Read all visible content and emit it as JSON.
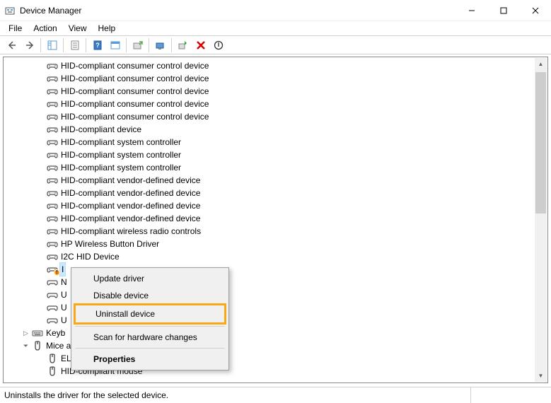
{
  "window": {
    "title": "Device Manager"
  },
  "menubar": {
    "file": "File",
    "action": "Action",
    "view": "View",
    "help": "Help"
  },
  "tree": {
    "devices": [
      "HID-compliant consumer control device",
      "HID-compliant consumer control device",
      "HID-compliant consumer control device",
      "HID-compliant consumer control device",
      "HID-compliant consumer control device",
      "HID-compliant device",
      "HID-compliant system controller",
      "HID-compliant system controller",
      "HID-compliant system controller",
      "HID-compliant vendor-defined device",
      "HID-compliant vendor-defined device",
      "HID-compliant vendor-defined device",
      "HID-compliant vendor-defined device",
      "HID-compliant wireless radio controls",
      "HP Wireless Button Driver",
      "I2C HID Device"
    ],
    "selected_warning": "I",
    "partial_labels": {
      "n": "N",
      "u1": "U",
      "u2": "U",
      "u3": "U"
    },
    "keyboards_label": "Keyb",
    "mice_label": "Mice and other pointing devices",
    "mice_children": {
      "elan": "ELAN Input Device",
      "hid_mouse": "HID-compliant mouse"
    }
  },
  "context_menu": {
    "update": "Update driver",
    "disable": "Disable device",
    "uninstall": "Uninstall device",
    "scan": "Scan for hardware changes",
    "properties": "Properties"
  },
  "statusbar": {
    "text": "Uninstalls the driver for the selected device."
  }
}
